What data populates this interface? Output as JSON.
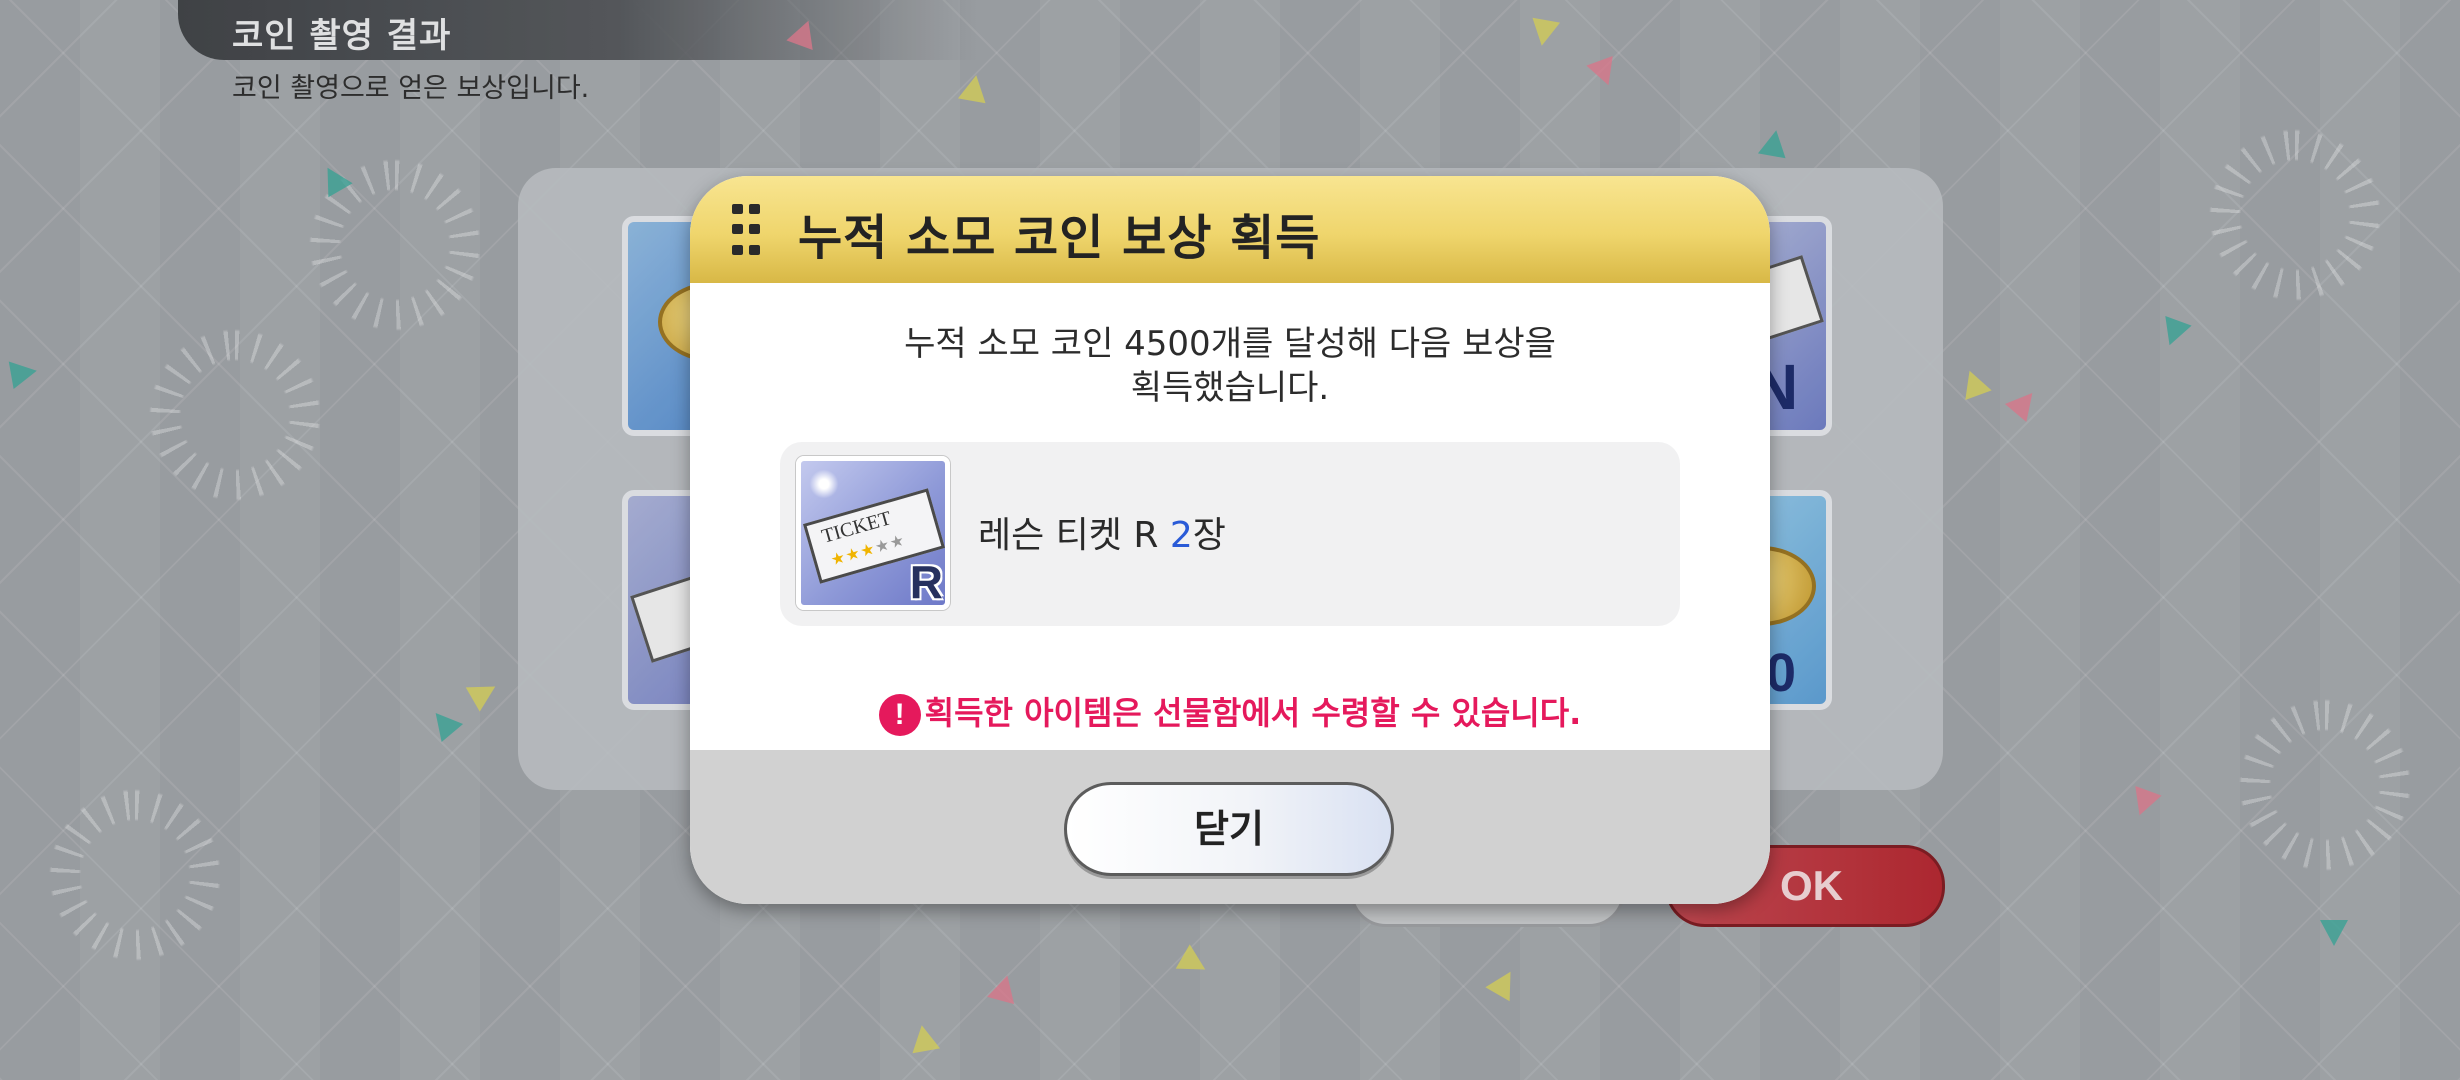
{
  "header": {
    "title": "코인 촬영 결과",
    "subtitle": "코인 촬영으로 얻은 보상입니다."
  },
  "background": {
    "ok_label": "OK",
    "card_fragments": [
      "N",
      "00"
    ]
  },
  "dialog": {
    "title": "누적 소모 코인 보상 획득",
    "message_line1": "누적 소모 코인 4500개를 달성해 다음 보상을",
    "message_line2": "획득했습니다.",
    "reward": {
      "name": "레슨 티켓 R ",
      "quantity": "2",
      "unit": "장",
      "icon": "lesson-ticket-r-icon",
      "icon_text": "TICKET",
      "rank": "R"
    },
    "notice_icon": "!",
    "notice": "획득한 아이템은 선물함에서 수령할 수 있습니다.",
    "close_label": "닫기"
  },
  "colors": {
    "header_gold": "#efd56c",
    "notice_pink": "#e5195c",
    "quantity_blue": "#2a5bd7",
    "ok_red": "#b3262f"
  }
}
